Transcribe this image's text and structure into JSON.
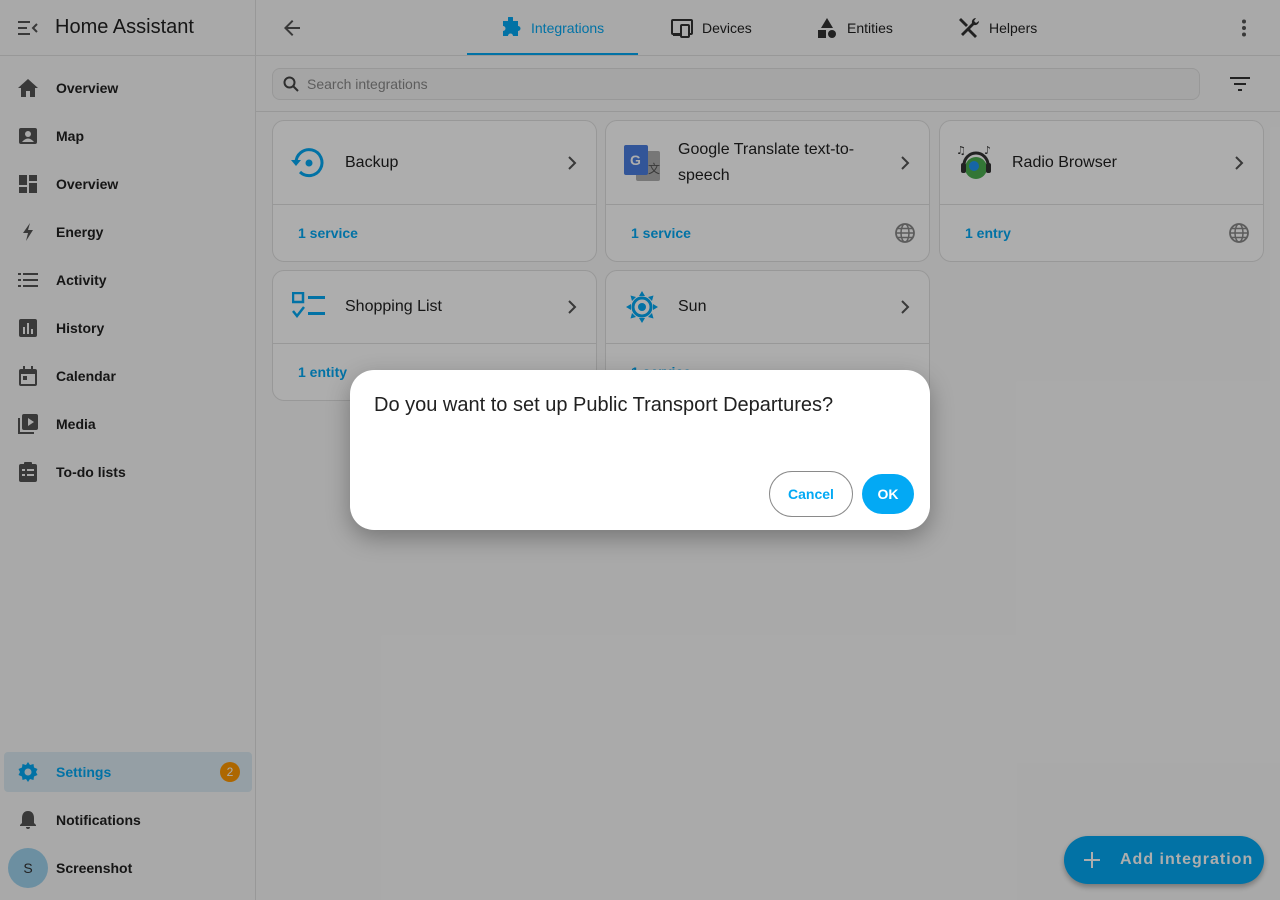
{
  "app": {
    "title": "Home Assistant"
  },
  "sidebar": {
    "items": [
      {
        "label": "Overview",
        "icon": "home-icon"
      },
      {
        "label": "Map",
        "icon": "map-icon"
      },
      {
        "label": "Overview",
        "icon": "dashboard-icon"
      },
      {
        "label": "Energy",
        "icon": "lightning-icon"
      },
      {
        "label": "Activity",
        "icon": "list-icon"
      },
      {
        "label": "History",
        "icon": "chart-icon"
      },
      {
        "label": "Calendar",
        "icon": "calendar-icon"
      },
      {
        "label": "Media",
        "icon": "media-icon"
      },
      {
        "label": "To-do lists",
        "icon": "clipboard-icon"
      }
    ],
    "settings": {
      "label": "Settings",
      "badge": "2"
    },
    "notifications": {
      "label": "Notifications"
    },
    "user": {
      "label": "Screenshot",
      "initial": "S"
    }
  },
  "tabs": [
    {
      "label": "Integrations",
      "active": true
    },
    {
      "label": "Devices",
      "active": false
    },
    {
      "label": "Entities",
      "active": false
    },
    {
      "label": "Helpers",
      "active": false
    }
  ],
  "search": {
    "placeholder": "Search integrations",
    "value": ""
  },
  "cards": [
    {
      "name": "Backup",
      "link": "1 service"
    },
    {
      "name": "Google Translate text-to-speech",
      "link": "1 service"
    },
    {
      "name": "Radio Browser",
      "link": "1 entry"
    },
    {
      "name": "Shopping List",
      "link": "1 entity"
    },
    {
      "name": "Sun",
      "link": "1 service"
    }
  ],
  "fab": {
    "label": "Add integration"
  },
  "dialog": {
    "title": "Do you want to set up Public Transport Departures?",
    "cancel_label": "Cancel",
    "ok_label": "OK"
  },
  "colors": {
    "accent": "#03a9f4",
    "badge": "#ff9800",
    "text": "#212121",
    "divider": "#e0e0e0"
  }
}
